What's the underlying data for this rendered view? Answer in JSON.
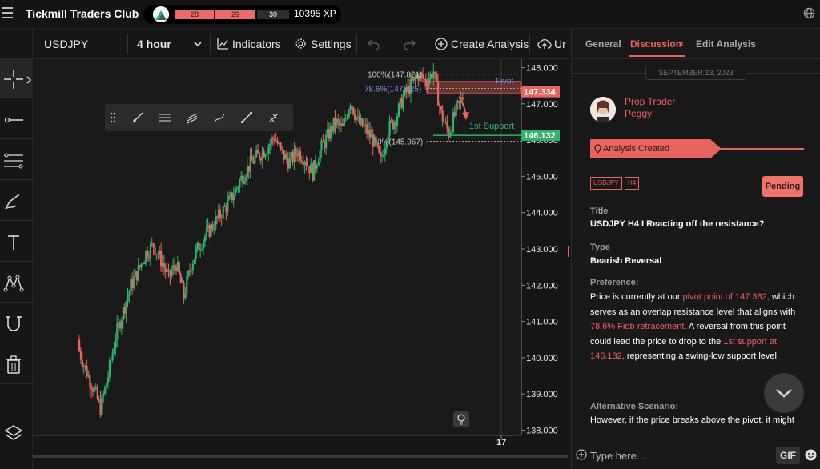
{
  "app": {
    "title": "Tickmill Traders Club",
    "xp_segments": [
      "28",
      "29",
      "30"
    ],
    "xp_text": "10395 XP"
  },
  "toolbar": {
    "symbol": "USDJPY",
    "interval": "4 hour",
    "indicators_label": "Indicators",
    "settings_label": "Settings",
    "create_analysis_label": "Create Analysis",
    "upload_label": "Ur"
  },
  "chart_data": {
    "type": "candlestick",
    "symbol": "USDJPY",
    "interval": "4 hour",
    "y_ticks": [
      "148.000",
      "147.000",
      "146.000",
      "145.000",
      "144.000",
      "143.000",
      "142.000",
      "141.000",
      "140.000",
      "139.000",
      "138.000"
    ],
    "ylim": [
      138.0,
      148.0
    ],
    "x_tick_labels": [
      "17"
    ],
    "price_labels": [
      {
        "value": "147.334",
        "color": "#e8645f"
      },
      {
        "value": "146.132",
        "color": "#2fb36c"
      }
    ],
    "annotations": [
      {
        "text": "100%(147.821)",
        "price": 147.821
      },
      {
        "text": "78.6%(147.425)",
        "price": 147.425
      },
      {
        "text": "0%(145.967)",
        "price": 145.967
      },
      {
        "text": "Pivot",
        "price": 147.382
      },
      {
        "text": "1st Support",
        "price": 146.132
      }
    ],
    "closes": [
      140.3,
      139.7,
      139.2,
      138.6,
      139.5,
      140.6,
      141.3,
      142.0,
      142.4,
      142.9,
      143.1,
      142.7,
      142.2,
      142.6,
      141.7,
      142.6,
      143.1,
      143.4,
      143.7,
      144.0,
      144.3,
      144.7,
      145.1,
      145.4,
      145.6,
      145.8,
      146.1,
      145.6,
      145.4,
      145.7,
      145.5,
      145.1,
      145.7,
      146.1,
      146.5,
      146.3,
      147.1,
      146.5,
      146.3,
      146.0,
      145.4,
      146.3,
      146.6,
      147.2,
      147.5,
      147.8,
      147.6,
      147.9,
      146.7,
      146.2,
      146.8,
      147.3
    ]
  },
  "panel": {
    "tabs": [
      "General",
      "Discussion",
      "Edit Analysis"
    ],
    "tab_close": "×",
    "date": "SEPTEMBER 13, 2023",
    "author_role": "Prop Trader",
    "author_name": "Peggy",
    "created_label": "Analysis Created",
    "tags": [
      "USDJPY",
      "H4"
    ],
    "status": "Pending",
    "title_label": "Title",
    "title_value": "USDJPY H4 I Reacting off the resistance?",
    "type_label": "Type",
    "type_value": "Bearish Reversal",
    "preference_label": "Preference:",
    "pref": {
      "t1": "Price is currently at our ",
      "h1": "pivot point of 147.382,",
      "t2": " which serves as an overlap resistance level that aligns with ",
      "h2": "78.6% Fiob retracement",
      "t3": ". A reversal from this point could lead the price to drop to the ",
      "h3": "1st support at 146.132,",
      "t4": " representing a swing-low support level."
    },
    "alt_label": "Alternative Scenario:",
    "alt_text": "However, if the price breaks above the pivot, it might",
    "composer_placeholder": "Type here...",
    "gif_label": "GIF"
  }
}
